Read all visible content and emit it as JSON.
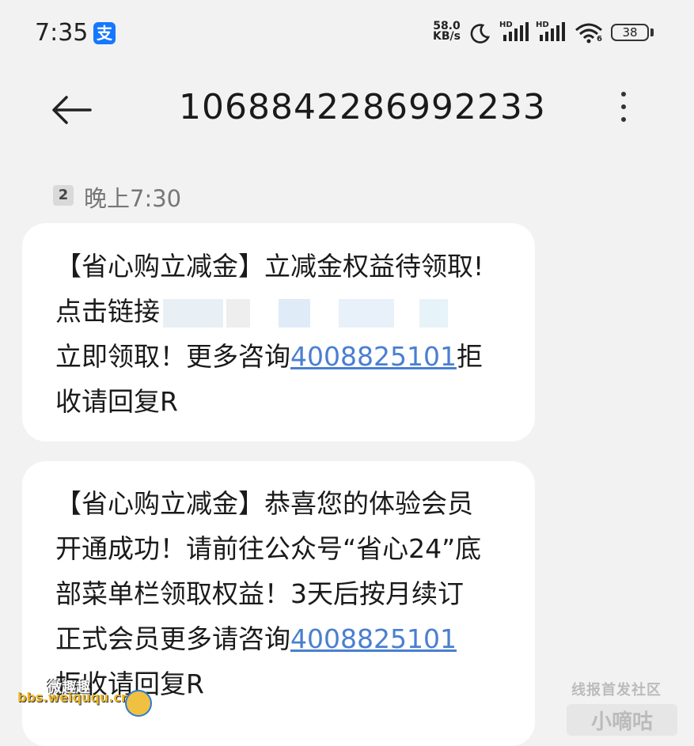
{
  "status_bar": {
    "time": "7:35",
    "alipay_icon_text": "支",
    "net_speed_value": "58.0",
    "net_speed_unit": "KB/s",
    "sim1_label": "HD",
    "sim2_label": "HD",
    "wifi_label": "6",
    "battery": "38",
    "icons": [
      "alipay-icon",
      "moon-icon",
      "signal-icon",
      "signal-icon",
      "wifi-icon",
      "battery-icon"
    ]
  },
  "header": {
    "title": "1068842286992233",
    "icons": [
      "back-arrow-icon",
      "more-vertical-icon"
    ]
  },
  "message_meta": {
    "sim_badge": "2",
    "time": "晚上7:30"
  },
  "messages": [
    {
      "lines": [
        "【省心购立减金】立减金权益待领取!",
        "点击链接",
        "立即领取！更多咨询",
        "收请回复R"
      ],
      "phone": "4008825101",
      "after_phone": "拒"
    },
    {
      "lines": [
        "【省心购立减金】恭喜您的体验会员",
        "开通成功！请前往公众号“省心24”底",
        "部菜单栏领取权益！3天后按月续订",
        "正式会员更多请咨询",
        "拒收请回复R"
      ],
      "phone": "4008825101"
    }
  ],
  "watermarks": {
    "left_top": "微趣趣",
    "left_url": "bbs.weiququ.cn",
    "right_top": "线报首发社区",
    "right_bottom": "小嘀咕"
  },
  "colors": {
    "background": "#f2f2f2",
    "bubble": "#ffffff",
    "link": "#4a7fd0",
    "alipay": "#1677ff"
  }
}
